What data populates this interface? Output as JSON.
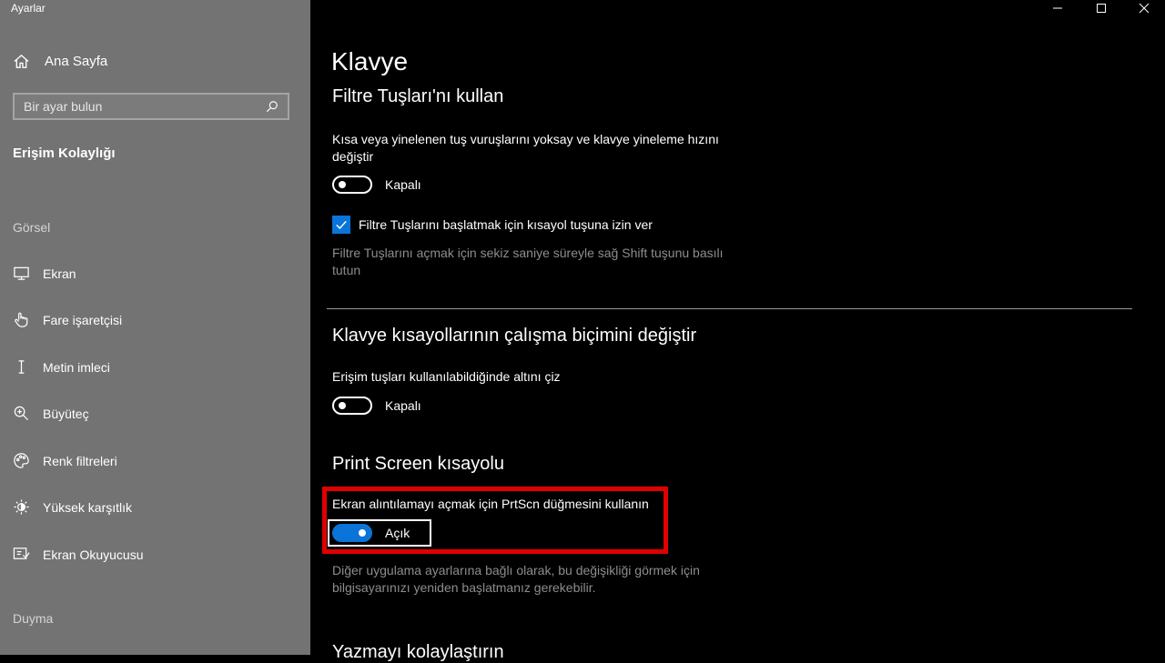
{
  "window": {
    "app_title": "Ayarlar"
  },
  "sidebar": {
    "home_label": "Ana Sayfa",
    "search_placeholder": "Bir ayar bulun",
    "section_title": "Erişim Kolaylığı",
    "group_visual": "Görsel",
    "items": [
      {
        "label": "Ekran",
        "icon": "monitor-icon"
      },
      {
        "label": "Fare işaretçisi",
        "icon": "mouse-pointer-icon"
      },
      {
        "label": "Metin imleci",
        "icon": "text-cursor-icon"
      },
      {
        "label": "Büyüteç",
        "icon": "magnifier-icon"
      },
      {
        "label": "Renk filtreleri",
        "icon": "color-filter-icon"
      },
      {
        "label": "Yüksek karşıtlık",
        "icon": "high-contrast-icon"
      },
      {
        "label": "Ekran Okuyucusu",
        "icon": "narrator-icon"
      }
    ],
    "group_hearing": "Duyma"
  },
  "main": {
    "page_title": "Klavye",
    "filter_keys": {
      "heading": "Filtre Tuşları'nı kullan",
      "description": "Kısa veya yinelenen tuş vuruşlarını yoksay ve klavye yineleme hızını değiştir",
      "toggle_state": "Kapalı",
      "checkbox_label": "Filtre Tuşlarını başlatmak için kısayol tuşuna izin ver",
      "hint": "Filtre Tuşlarını açmak için sekiz saniye süreyle sağ Shift tuşunu basılı tutun"
    },
    "shortcuts": {
      "heading": "Klavye kısayollarının çalışma biçimini değiştir",
      "description": "Erişim tuşları kullanılabildiğinde altını çiz",
      "toggle_state": "Kapalı"
    },
    "print_screen": {
      "heading": "Print Screen kısayolu",
      "description": "Ekran alıntılamayı açmak için PrtScn düğmesini kullanın",
      "toggle_state": "Açık",
      "hint": "Diğer uygulama ayarlarına bağlı olarak, bu değişikliği görmek için bilgisayarınızı yeniden başlatmanız gerekebilir."
    },
    "next_heading": "Yazmayı kolaylaştırın"
  },
  "colors": {
    "accent": "#0a74d9",
    "sidebar_bg": "#737373",
    "highlight": "#e00000"
  }
}
